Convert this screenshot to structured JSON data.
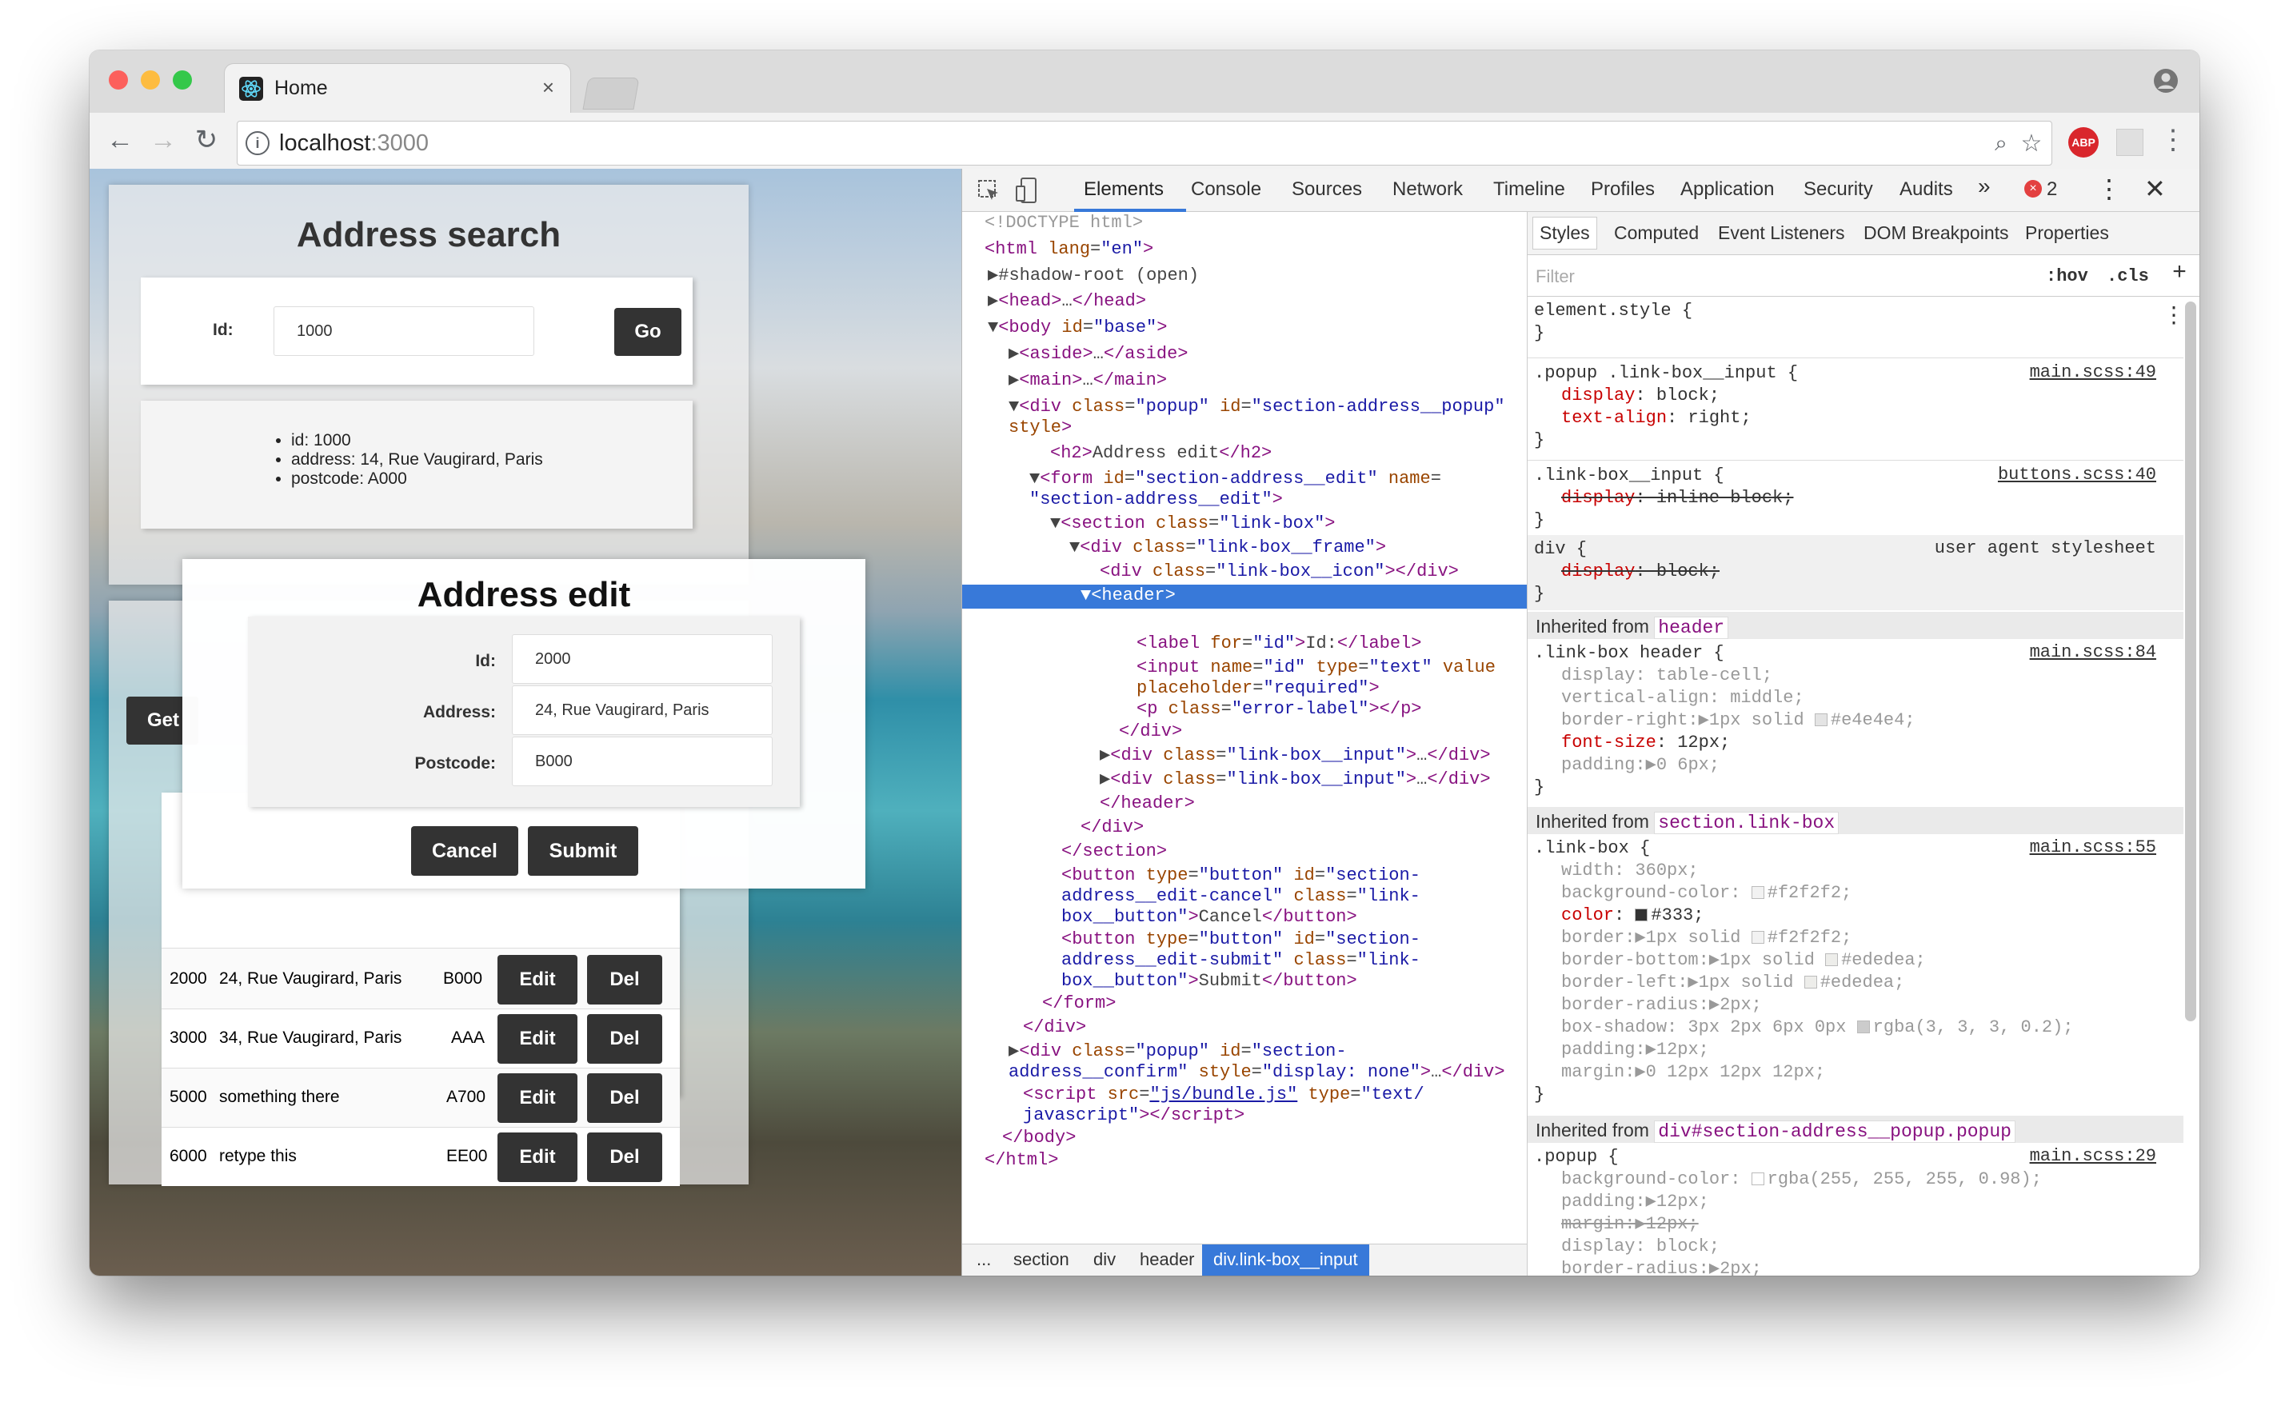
{
  "browser": {
    "tab_title": "Home",
    "url_host": "localhost",
    "url_port": ":3000",
    "abp": "ABP"
  },
  "page": {
    "search_title": "Address search",
    "search_id_label": "Id:",
    "search_id_value": "1000",
    "go_label": "Go",
    "result_items": [
      "id: 1000",
      "address: 14, Rue Vaugirard, Paris",
      "postcode: A000"
    ],
    "get_label": "Get",
    "rows": [
      {
        "id": "2000",
        "address": "24, Rue Vaugirard, Paris",
        "postcode": "B000"
      },
      {
        "id": "3000",
        "address": "34, Rue Vaugirard, Paris",
        "postcode": "AAA"
      },
      {
        "id": "5000",
        "address": "something there",
        "postcode": "A700"
      },
      {
        "id": "6000",
        "address": "retype this",
        "postcode": "EE00"
      }
    ],
    "edit_label": "Edit",
    "del_label": "Del",
    "popup": {
      "title": "Address edit",
      "id_label": "Id:",
      "id_value": "2000",
      "address_label": "Address:",
      "address_value": "24, Rue Vaugirard, Paris",
      "postcode_label": "Postcode:",
      "postcode_value": "B000",
      "cancel": "Cancel",
      "submit": "Submit"
    }
  },
  "devtools": {
    "tabs": [
      "Elements",
      "Console",
      "Sources",
      "Network",
      "Timeline",
      "Profiles",
      "Application",
      "Security",
      "Audits"
    ],
    "more": "»",
    "error_count": "2",
    "sub_tabs": [
      "Styles",
      "Computed",
      "Event Listeners",
      "DOM Breakpoints",
      "Properties"
    ],
    "filter_placeholder": "Filter",
    "hov": ":hov",
    "cls": ".cls",
    "crumbs": [
      "...",
      "section",
      "div",
      "header",
      "div.link-box__input"
    ]
  },
  "colors": {
    "accent": "#3879d9",
    "button": "#333333",
    "tag": "#881280",
    "attr": "#994500",
    "value": "#1a1aa6"
  },
  "icons": [
    "react-logo-icon",
    "close-icon",
    "back-icon",
    "forward-icon",
    "reload-icon",
    "info-icon",
    "zoom-icon",
    "star-icon",
    "abp-icon",
    "extension-icon",
    "menu-icon",
    "profile-icon",
    "inspect-icon",
    "device-icon",
    "error-icon",
    "kebab-icon"
  ]
}
